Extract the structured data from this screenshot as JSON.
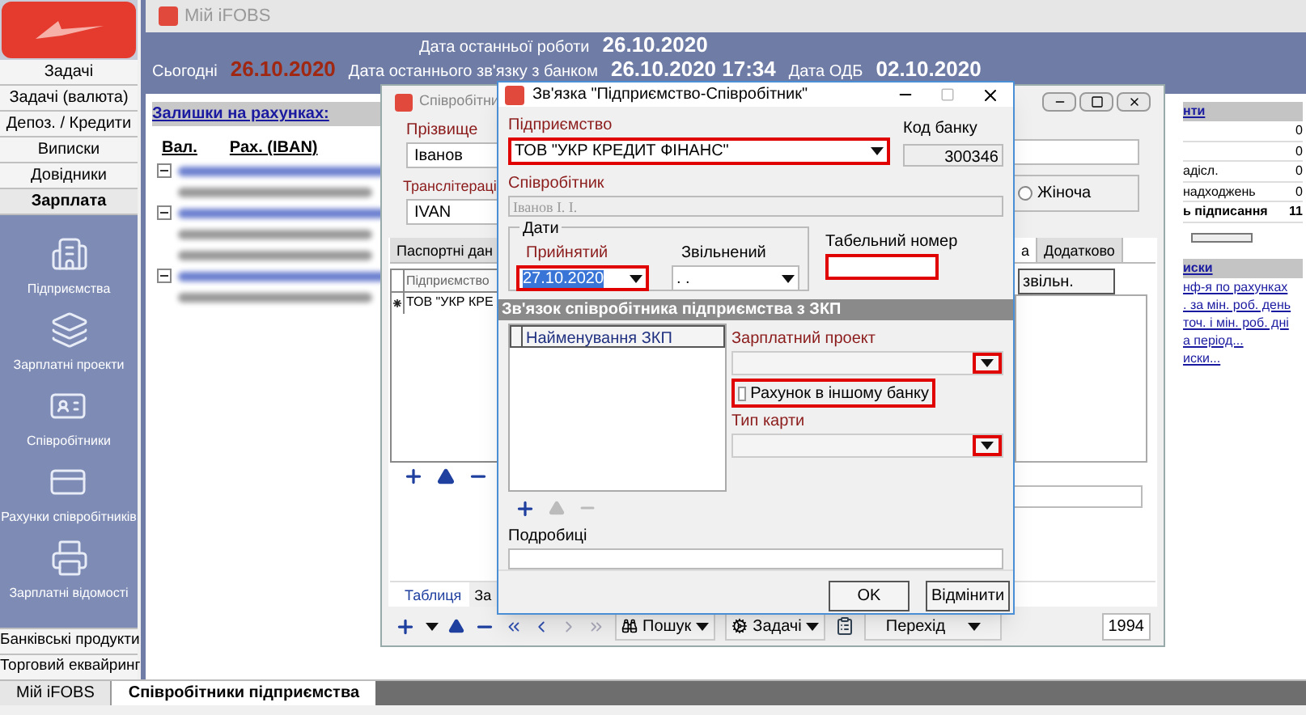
{
  "sidebar": {
    "menu": [
      {
        "label": "Задачі",
        "selected": false
      },
      {
        "label": "Задачі (валюта)",
        "selected": false
      },
      {
        "label": "Депоз. / Кредити",
        "selected": false
      },
      {
        "label": "Виписки",
        "selected": false
      },
      {
        "label": "Довідники",
        "selected": false
      },
      {
        "label": "Зарплата",
        "selected": true
      }
    ],
    "items": [
      {
        "label": "Підприємства",
        "kind": "building"
      },
      {
        "label": "Зарплатні проекти",
        "kind": "cards"
      },
      {
        "label": "Співробітники",
        "kind": "badge"
      },
      {
        "label": "Рахунки співробітників",
        "kind": "card"
      },
      {
        "label": "Зарплатні відомості",
        "kind": "printer"
      }
    ],
    "bottom_menu": [
      "Банківські продукти",
      "Торговий еквайринг"
    ]
  },
  "main_window": {
    "title": "Мій iFOBS",
    "last_work_label": "Дата останньої роботи",
    "last_work": "26.10.2020",
    "today_label": "Сьогодні",
    "today": "26.10.2020",
    "last_contact_label": "Дата останнього зв'язку з банком",
    "last_contact": "26.10.2020 17:34",
    "odb_label": "Дата ОДБ",
    "odb": "02.10.2020"
  },
  "balances": {
    "title": "Залишки на рахунках:",
    "columns": [
      "Вал.",
      "Рах. (IBAN)"
    ],
    "rows": [
      {
        "kind": "group",
        "expanded": true
      },
      {
        "kind": "account"
      },
      {
        "kind": "group",
        "expanded": true
      },
      {
        "kind": "account"
      },
      {
        "kind": "account"
      },
      {
        "kind": "group",
        "expanded": true
      },
      {
        "kind": "account"
      }
    ]
  },
  "right_panel": {
    "title": "нти",
    "counters": [
      {
        "value": "0",
        "bold": false
      },
      {
        "value": "0",
        "bold": false
      },
      {
        "label": "адісл.",
        "value": "0",
        "bold": false
      },
      {
        "label": "надходжень",
        "value": "0",
        "bold": false
      },
      {
        "label": "ь підписання",
        "value": "11",
        "bold": true
      }
    ],
    "links_title": "иски",
    "links": [
      "нф-я по рахунках",
      ". за мін. роб. день",
      "точ. і мін. роб. дні",
      "а період...",
      "иски..."
    ]
  },
  "employee_window": {
    "title": "Співробітни",
    "surname_label": "Прізвище",
    "surname": "Іванов",
    "translit_label": "Транслітераці",
    "translit": "IVAN",
    "gender_option": {
      "label": "Жіноча",
      "selected": false
    },
    "tabs": [
      {
        "label": "Паспортні дан",
        "selected": false
      },
      {
        "label": "а",
        "selected": true
      },
      {
        "label": "Додатково",
        "selected": false
      }
    ],
    "grid_columns": [
      "Підприємство",
      "звільн."
    ],
    "grid_rows": [
      "ТОВ \"УКР КРЕ"
    ],
    "bottom_tabs": [
      {
        "label": "Таблиця",
        "selected": true
      },
      {
        "label": "За",
        "selected": false
      }
    ],
    "toolbar": {
      "search": "Пошук",
      "tasks": "Задачі",
      "goto": "Перехід",
      "count": "1994"
    }
  },
  "dialog": {
    "title": "Зв'язка \"Підприємство-Співробітник\"",
    "enterprise": {
      "label": "Підприємство",
      "value": "ТОВ \"УКР КРЕДИТ ФІНАНС\"",
      "required": true,
      "highlighted": true
    },
    "bank_code": {
      "label": "Код банку",
      "value": "300346",
      "required": false
    },
    "employee": {
      "label": "Співробітник",
      "value": "Іванов І. І.",
      "required": true
    },
    "dates_title": "Дати",
    "hired": {
      "label": "Прийнятий",
      "value": "27.10.2020",
      "required": true,
      "highlighted": true
    },
    "dismissed": {
      "label": "Звільнений",
      "value": ". .",
      "required": false,
      "highlighted": false
    },
    "tab_number": {
      "label": "Табельний номер",
      "required": false,
      "highlighted": true
    },
    "section_title": "Зв'язок співробітника підприємства з ЗКП",
    "zkp_column": "Найменування ЗКП",
    "salary_project": {
      "label": "Зарплатний проект",
      "required": true,
      "highlighted": true
    },
    "other_bank": {
      "label": "Рахунок в іншому банку",
      "checked": false,
      "highlighted": true
    },
    "card_type": {
      "label": "Тип карти",
      "required": true,
      "highlighted": true
    },
    "details_label": "Подробиці",
    "buttons": [
      "OK",
      "Відмінити"
    ]
  },
  "taskbar_tabs": [
    {
      "label": "Мій iFOBS",
      "selected": false
    },
    {
      "label": "Співробітники підприємства",
      "selected": true
    }
  ]
}
